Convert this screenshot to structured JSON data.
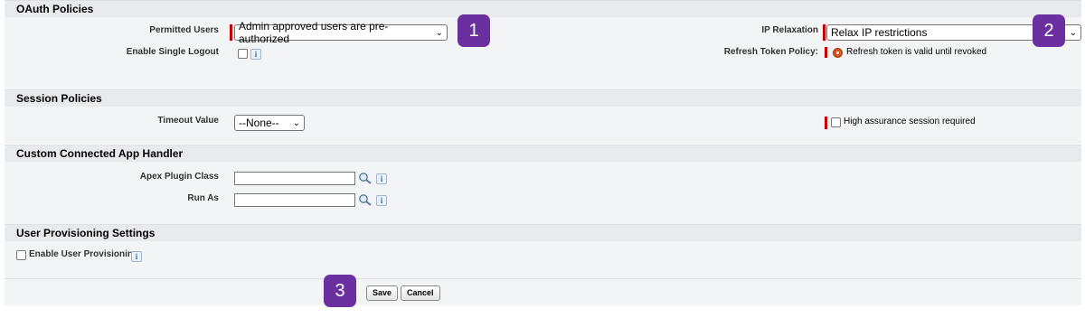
{
  "oauth": {
    "header": "OAuth Policies",
    "permitted_users_label": "Permitted Users",
    "permitted_users_value": "Admin approved users are pre-authorized",
    "enable_single_logout_label": "Enable Single Logout",
    "ip_relaxation_label": "IP Relaxation",
    "ip_relaxation_value": "Relax IP restrictions",
    "refresh_token_policy_label": "Refresh Token Policy:",
    "refresh_token_value": "Refresh token is valid until revoked"
  },
  "session": {
    "header": "Session Policies",
    "timeout_label": "Timeout Value",
    "timeout_value": "--None--",
    "high_assurance_label": "High assurance session required"
  },
  "handler": {
    "header": "Custom Connected App Handler",
    "apex_plugin_label": "Apex Plugin Class",
    "run_as_label": "Run As"
  },
  "provisioning": {
    "header": "User Provisioning Settings",
    "enable_label": "Enable User Provisioning"
  },
  "buttons": {
    "save": "Save",
    "cancel": "Cancel"
  },
  "badges": {
    "b1": "1",
    "b2": "2",
    "b3": "3"
  },
  "info_glyph": "i",
  "colors": {
    "header_bg": "#e8eaed",
    "body_bg": "#f3f4f6",
    "required_bar": "#cc0000",
    "badge": "#6b2fa0"
  }
}
